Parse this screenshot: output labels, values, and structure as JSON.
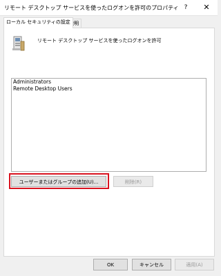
{
  "window": {
    "title": "リモート デスクトップ サービスを使ったログオンを許可のプロパティ",
    "help_glyph": "?",
    "close_glyph": "✕"
  },
  "tabs": [
    {
      "label": "ローカル セキュリティの設定",
      "active": true
    },
    {
      "label": "説明",
      "active": false
    }
  ],
  "policy": {
    "icon": "policy-computer-icon",
    "title": "リモート デスクトップ サービスを使ったログオンを許可"
  },
  "members": [
    "Administrators",
    "Remote Desktop Users"
  ],
  "buttons": {
    "add_label": "ユーザーまたはグループの追加(U)...",
    "remove_label": "削除(R)",
    "ok_label": "OK",
    "cancel_label": "キャンセル",
    "apply_label": "適用(A)"
  },
  "colors": {
    "highlight": "#d9121f",
    "disabled_text": "#9a9a9a"
  }
}
